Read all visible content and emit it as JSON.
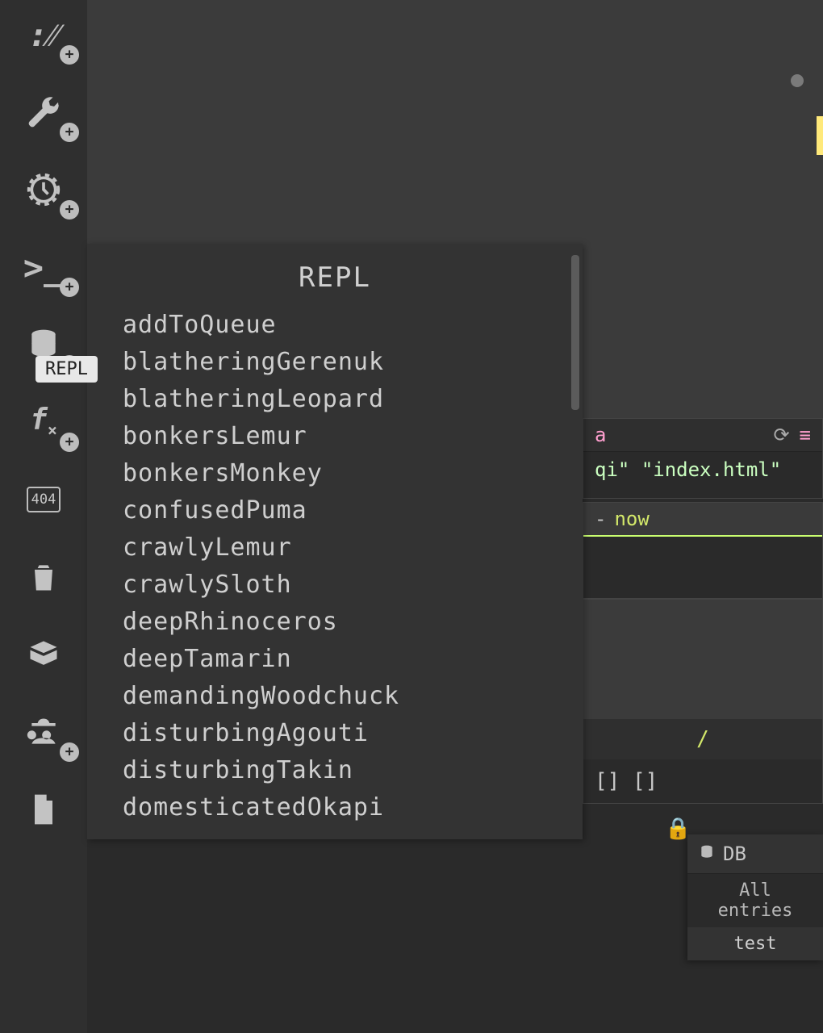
{
  "rail": {
    "tooltip": "REPL",
    "items": [
      {
        "name": "logo",
        "has_plus": true
      },
      {
        "name": "wrench",
        "has_plus": true
      },
      {
        "name": "gauge",
        "has_plus": true
      },
      {
        "name": "prompt",
        "has_plus": true
      },
      {
        "name": "database",
        "has_plus": true
      },
      {
        "name": "fx",
        "has_plus": true
      },
      {
        "name": "404",
        "has_plus": false
      },
      {
        "name": "trash",
        "has_plus": false
      },
      {
        "name": "box",
        "has_plus": false
      },
      {
        "name": "spy",
        "has_plus": true
      },
      {
        "name": "file",
        "has_plus": false
      }
    ]
  },
  "repl": {
    "title": "REPL",
    "items": [
      "addToQueue",
      "blatheringGerenuk",
      "blatheringLeopard",
      "bonkersLemur",
      "bonkersMonkey",
      "confusedPuma",
      "crawlyLemur",
      "crawlySloth",
      "deepRhinoceros",
      "deepTamarin",
      "demandingWoodchuck",
      "disturbingAgouti",
      "disturbingTakin",
      "domesticatedOkapi"
    ]
  },
  "right": {
    "a": {
      "head_frag": "a",
      "file_frag1": "qi\"",
      "file_frag2": "\"index.html\""
    },
    "b": {
      "dash": "-",
      "fn": "now"
    },
    "c": {
      "slash": "/",
      "body": "[] []"
    }
  },
  "db": {
    "title": "DB",
    "subtitle": "All entries",
    "row": "test"
  }
}
